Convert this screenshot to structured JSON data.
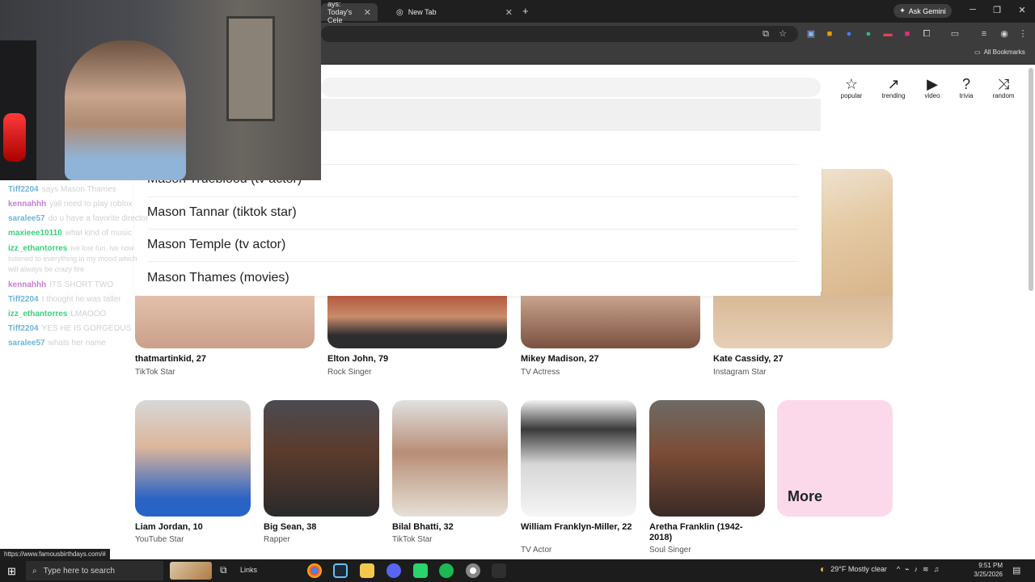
{
  "browser": {
    "tabs": [
      {
        "label": "ays: Today's Cele",
        "active": true
      },
      {
        "label": "New Tab",
        "active": false
      }
    ],
    "new_tab_symbol": "+",
    "gemini_label": "Ask Gemini",
    "bookmarks_label": "All Bookmarks"
  },
  "nav": [
    {
      "label": "popular",
      "icon": "star-icon"
    },
    {
      "label": "trending",
      "icon": "trending-icon"
    },
    {
      "label": "video",
      "icon": "video-icon"
    },
    {
      "label": "trivia",
      "icon": "question-icon"
    },
    {
      "label": "random",
      "icon": "shuffle-icon"
    }
  ],
  "dropdown": {
    "items": [
      "Mason Trueblood (tv actor)",
      "Mason Tannar (tiktok star)",
      "Mason Temple (tv actor)",
      "Mason Thames (movies)"
    ]
  },
  "row1": [
    {
      "name": "thatmartinkid, 27",
      "role": "TikTok Star"
    },
    {
      "name": "Elton John, 79",
      "role": "Rock Singer"
    },
    {
      "name": "Mikey Madison, 27",
      "role": "TV Actress"
    },
    {
      "name": "Kate Cassidy, 27",
      "role": "Instagram Star"
    }
  ],
  "row2": [
    {
      "name": "Liam Jordan, 10",
      "role": "YouTube Star"
    },
    {
      "name": "Big Sean, 38",
      "role": "Rapper"
    },
    {
      "name": "Bilal Bhatti, 32",
      "role": "TikTok Star"
    },
    {
      "name": "William Franklyn-Miller, 22",
      "role": "TV Actor"
    },
    {
      "name": "Aretha Franklin (1942-2018)",
      "role": "Soul Singer"
    }
  ],
  "more_label": "More",
  "chat": [
    {
      "user": "Tiff2204",
      "color": "#6fb4d9",
      "msg": "says Mason Thames"
    },
    {
      "user": "kennahhh",
      "color": "#c77dd9",
      "msg": "yall need to play roblox"
    },
    {
      "user": "saralee57",
      "color": "#6fb4d9",
      "msg": "do u have a favorite director"
    },
    {
      "user": "maxieee10110",
      "color": "#3ccf7d",
      "msg": "what kind of music"
    },
    {
      "user": "izz_ethantorres",
      "color": "#3ccf7d",
      "msg": "ive lost fun. ive now listened to everything in my mood which will always be crazy fire"
    },
    {
      "user": "kennahhh",
      "color": "#c77dd9",
      "msg": "ITS SHORT TWO"
    },
    {
      "user": "Tiff2204",
      "color": "#6fb4d9",
      "msg": "I thought he was taller"
    },
    {
      "user": "izz_ethantorres",
      "color": "#3ccf7d",
      "msg": "LMAOOO"
    },
    {
      "user": "Tiff2204",
      "color": "#6fb4d9",
      "msg": "YES HE IS GORGEOUS"
    },
    {
      "user": "saralee57",
      "color": "#6fb4d9",
      "msg": "whats her name"
    }
  ],
  "status_url": "https://www.famousbirthdays.com/#",
  "taskbar": {
    "search_placeholder": "Type here to search",
    "links_label": "Links",
    "weather": "29°F  Mostly clear",
    "time": "9:51 PM",
    "date": "3/25/2026"
  },
  "colors": {
    "more_card": "#fbd9eb",
    "chrome_dark": "#1f1f1f"
  }
}
